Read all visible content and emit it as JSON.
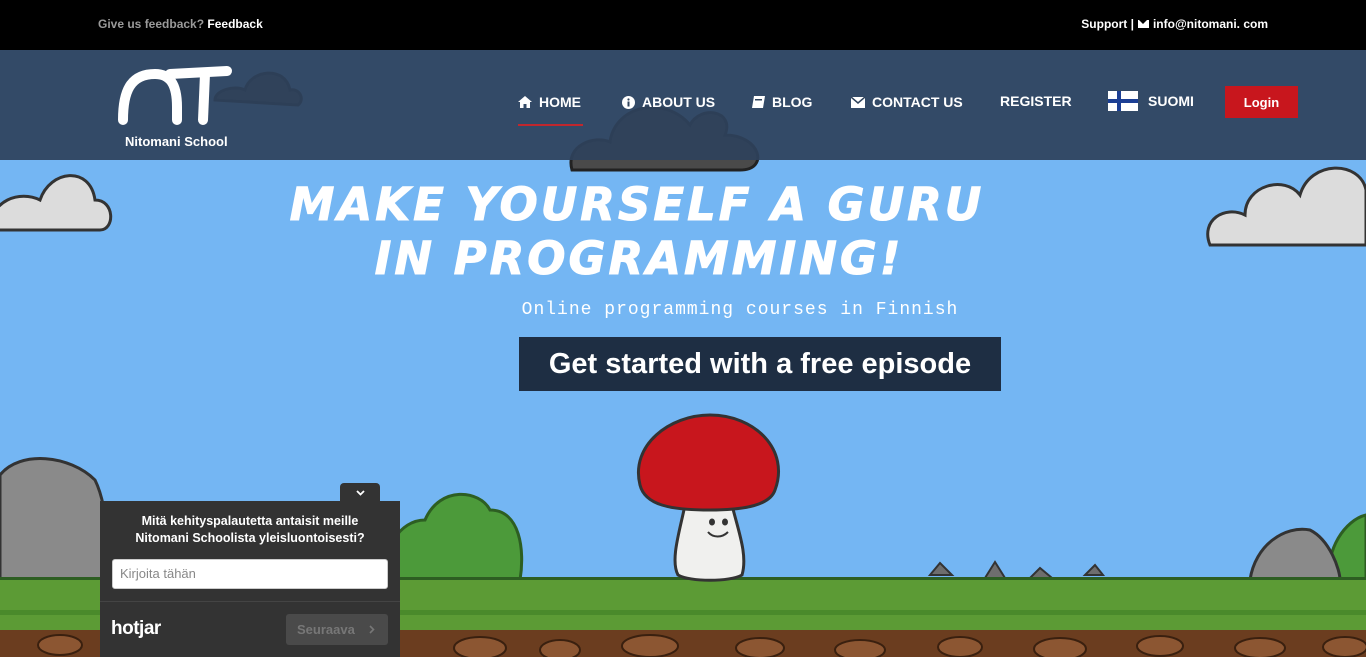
{
  "topbar": {
    "feedback_prompt": "Give us feedback?",
    "feedback_link": "Feedback",
    "support_label": "Support |",
    "support_email": "info@nitomani. com"
  },
  "brand": {
    "name": "Nitomani School"
  },
  "nav": {
    "items": [
      {
        "label": "HOME",
        "icon": "home-icon"
      },
      {
        "label": "ABOUT US",
        "icon": "info-icon"
      },
      {
        "label": "BLOG",
        "icon": "book-icon"
      },
      {
        "label": "CONTACT US",
        "icon": "envelope-icon"
      },
      {
        "label": "REGISTER"
      },
      {
        "label": "SUOMI",
        "icon": "finland-flag-icon"
      }
    ],
    "login_label": "Login"
  },
  "hero": {
    "title_line1": "MAKE YOURSELF A GURU",
    "title_line2": "IN PROGRAMMING!",
    "subtitle": "Online programming courses in Finnish",
    "cta_label": "Get started with a free episode"
  },
  "survey": {
    "question": "Mitä kehityspalautetta antaisit meille Nitomani Schoolista yleisluontoisesti?",
    "input_placeholder": "Kirjoita tähän",
    "next_label": "Seuraava",
    "brand": "hotjar"
  },
  "colors": {
    "sky": "#74b6f3",
    "nav_bg": "#2e425b",
    "accent_red": "#c8161d",
    "cta_bg": "#1e2e43"
  }
}
